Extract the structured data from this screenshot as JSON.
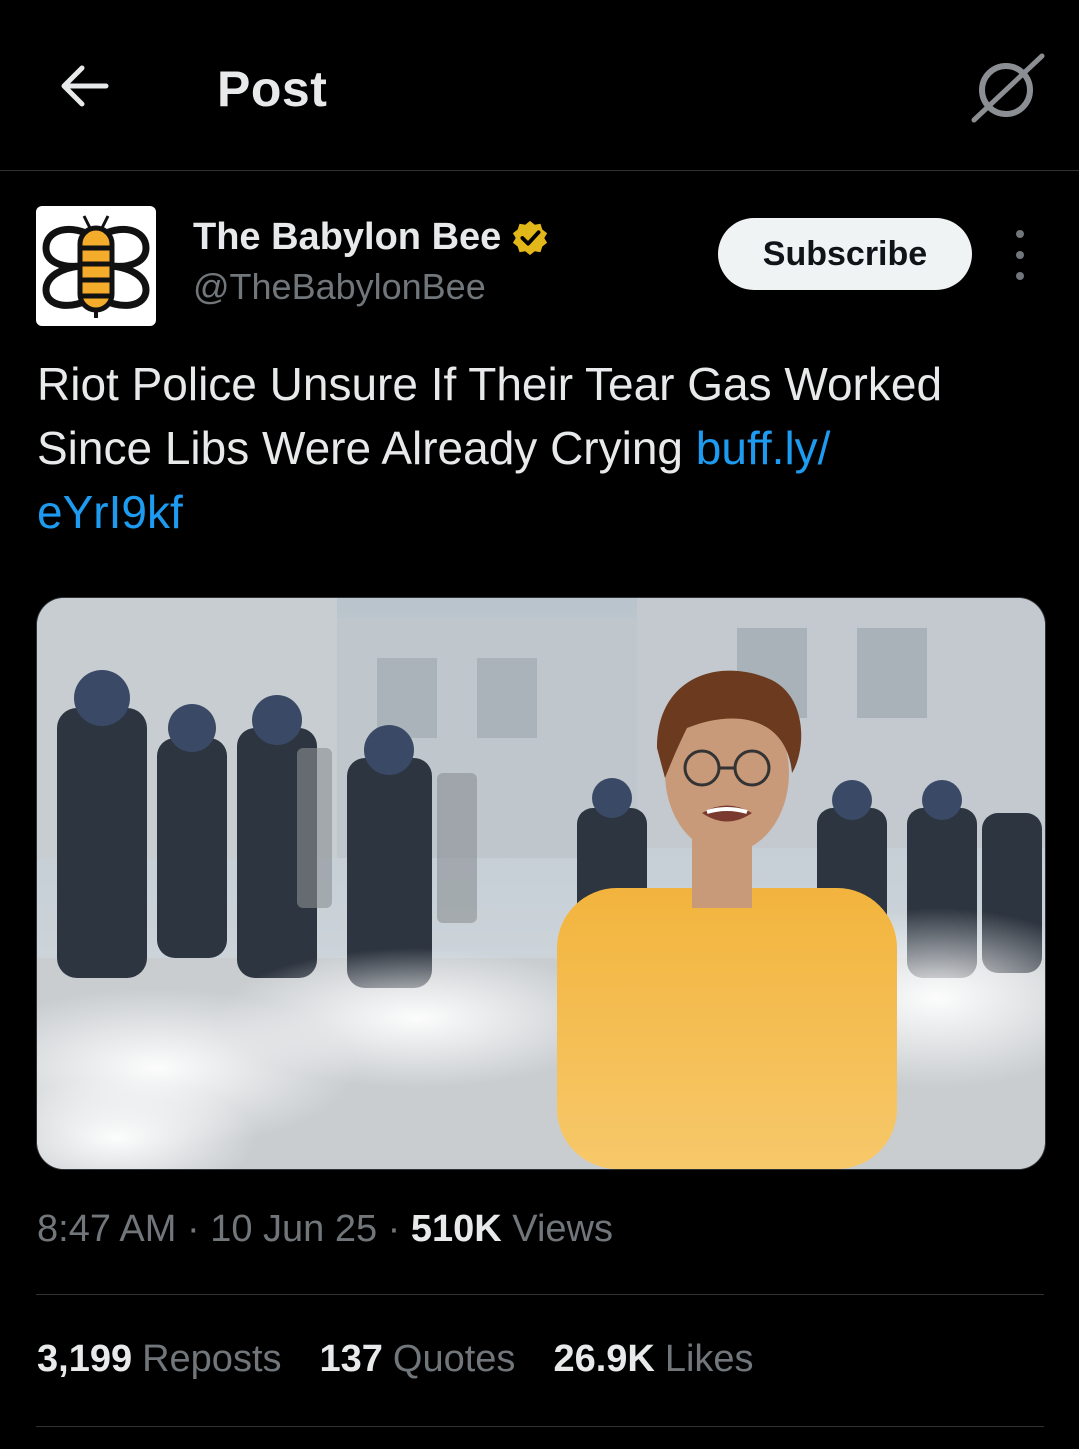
{
  "header": {
    "title": "Post"
  },
  "author": {
    "name": "The Babylon Bee",
    "handle": "@TheBabylonBee",
    "verified_color": "#e2b719",
    "subscribe_label": "Subscribe"
  },
  "post": {
    "text": "Riot Police Unsure If Their Tear Gas Worked Since Libs Were Already Crying ",
    "link": "buff.ly/\neYrI9kf"
  },
  "meta": {
    "time": "8:47 AM",
    "sep1": " · ",
    "date": "10 Jun 25",
    "sep2": " · ",
    "views_count": "510K",
    "views_label": " Views"
  },
  "stats": {
    "reposts_count": "3,199",
    "reposts_label": "Reposts",
    "quotes_count": "137",
    "quotes_label": "Quotes",
    "likes_count": "26.9K",
    "likes_label": "Likes"
  },
  "icons": {
    "back": "back-arrow-icon",
    "grok": "grok-icon",
    "more": "more-icon",
    "verified": "verified-badge-icon"
  },
  "colors": {
    "background": "#000000",
    "link": "#1d9bf0",
    "secondary_text": "#71767b"
  }
}
